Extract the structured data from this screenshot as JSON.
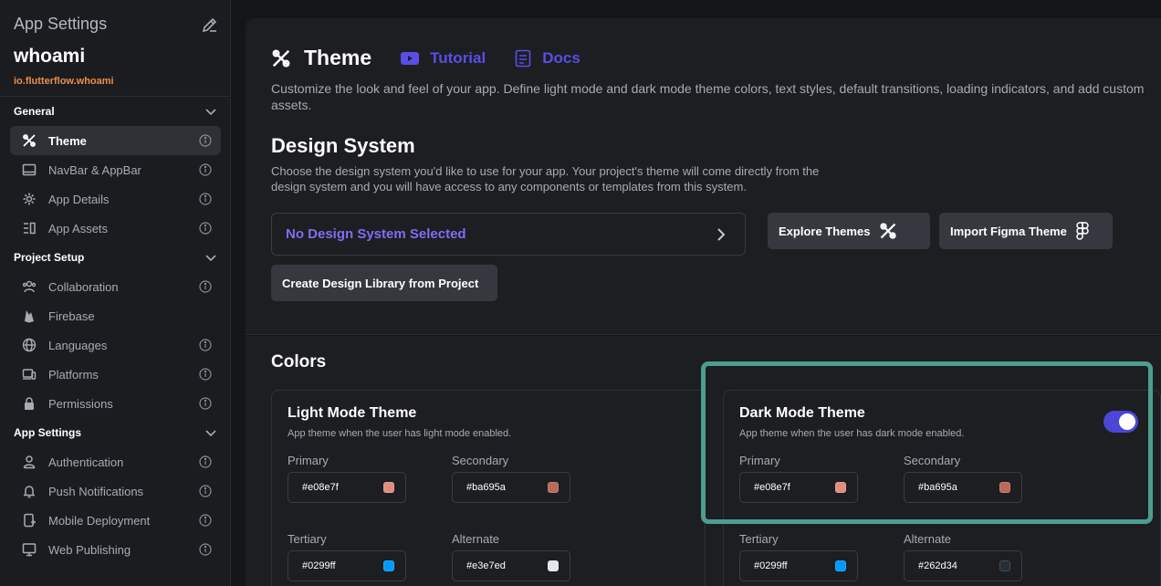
{
  "sidebar": {
    "title": "App Settings",
    "project_name": "whoami",
    "package": "io.flutterflow.whoami",
    "sections": [
      {
        "label": "General",
        "items": [
          {
            "label": "Theme",
            "active": true
          },
          {
            "label": "NavBar & AppBar"
          },
          {
            "label": "App Details"
          },
          {
            "label": "App Assets"
          }
        ]
      },
      {
        "label": "Project Setup",
        "items": [
          {
            "label": "Collaboration"
          },
          {
            "label": "Firebase"
          },
          {
            "label": "Languages"
          },
          {
            "label": "Platforms"
          },
          {
            "label": "Permissions"
          }
        ]
      },
      {
        "label": "App Settings",
        "items": [
          {
            "label": "Authentication"
          },
          {
            "label": "Push Notifications"
          },
          {
            "label": "Mobile Deployment"
          },
          {
            "label": "Web Publishing"
          }
        ]
      }
    ]
  },
  "header": {
    "title": "Theme",
    "tutorial": "Tutorial",
    "docs": "Docs",
    "description": "Customize the look and feel of your app. Define light mode and dark mode theme colors, text styles, default transitions, loading indicators, and add custom assets."
  },
  "design_system": {
    "title": "Design System",
    "description": "Choose the design system you'd like to use for your app. Your project's theme will come directly from the design system and you will have access to any components or templates from this system.",
    "selected": "No Design System Selected",
    "explore_button": "Explore Themes",
    "import_button": "Import Figma Theme",
    "create_button": "Create Design Library from Project"
  },
  "colors": {
    "title": "Colors",
    "light": {
      "title": "Light Mode Theme",
      "description": "App theme when the user has light mode enabled.",
      "primary_label": "Primary",
      "primary": "#e08e7f",
      "secondary_label": "Secondary",
      "secondary": "#ba695a",
      "tertiary_label": "Tertiary",
      "tertiary": "#0299ff",
      "alternate_label": "Alternate",
      "alternate": "#e3e7ed"
    },
    "dark": {
      "title": "Dark Mode Theme",
      "description": "App theme when the user has dark mode enabled.",
      "enabled": true,
      "primary_label": "Primary",
      "primary": "#e08e7f",
      "secondary_label": "Secondary",
      "secondary": "#ba695a",
      "tertiary_label": "Tertiary",
      "tertiary": "#0299ff",
      "alternate_label": "Alternate",
      "alternate": "#262d34"
    }
  },
  "accent_color": "#5a4ee6",
  "highlight_color": "#4c9e8f"
}
